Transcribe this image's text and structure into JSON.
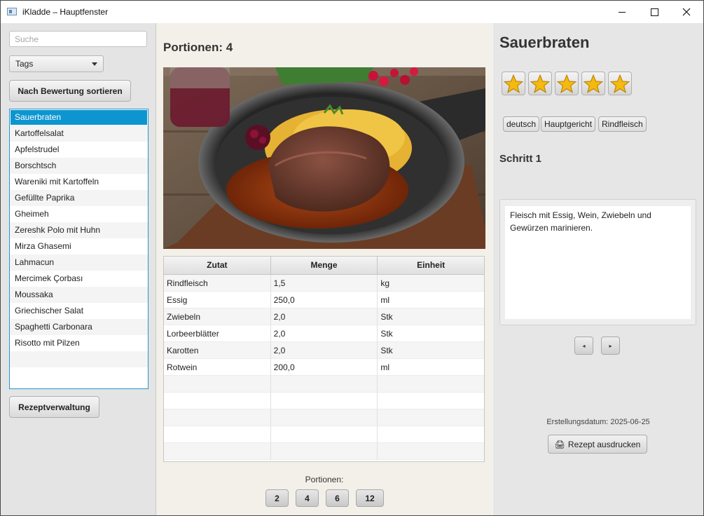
{
  "window": {
    "title": "iKladde – Hauptfenster"
  },
  "sidebar": {
    "search_placeholder": "Suche",
    "tags_combo": "Tags",
    "sort_button": "Nach Bewertung sortieren",
    "manage_button": "Rezeptverwaltung",
    "recipes": [
      "Sauerbraten",
      "Kartoffelsalat",
      "Apfelstrudel",
      "Borschtsch",
      "Wareniki mit Kartoffeln",
      "Gefüllte Paprika",
      "Gheimeh",
      "Zereshk Polo mit Huhn",
      "Mirza Ghasemi",
      "Lahmacun",
      "Mercimek Çorbası",
      "Moussaka",
      "Griechischer Salat",
      "Spaghetti Carbonara",
      "Risotto mit Pilzen"
    ],
    "selected_index": 0
  },
  "middle": {
    "portion_heading": "Portionen: 4",
    "image_alt": "Sauerbraten mit Spätzle",
    "table": {
      "columns": [
        "Zutat",
        "Menge",
        "Einheit"
      ],
      "rows": [
        [
          "Rindfleisch",
          "1,5",
          "kg"
        ],
        [
          "Essig",
          "250,0",
          "ml"
        ],
        [
          "Zwiebeln",
          "2,0",
          "Stk"
        ],
        [
          "Lorbeerblätter",
          "2,0",
          "Stk"
        ],
        [
          "Karotten",
          "2,0",
          "Stk"
        ],
        [
          "Rotwein",
          "200,0",
          "ml"
        ]
      ]
    },
    "portions_label": "Portionen:",
    "portion_buttons": [
      "2",
      "4",
      "6",
      "12"
    ]
  },
  "detail": {
    "title": "Sauerbraten",
    "rating": 5,
    "rating_max": 5,
    "star_color": "#f5b90f",
    "tags": [
      "deutsch",
      "Hauptgericht",
      "Rindfleisch"
    ],
    "step_title": "Schritt 1",
    "step_text": "Fleisch mit Essig, Wein, Zwiebeln und Gewürzen marinieren.",
    "prev_icon": "◂",
    "next_icon": "▸",
    "created": "Erstellungsdatum: 2025-06-25",
    "print_icon": "🖨",
    "print_button": "Rezept ausdrucken"
  }
}
